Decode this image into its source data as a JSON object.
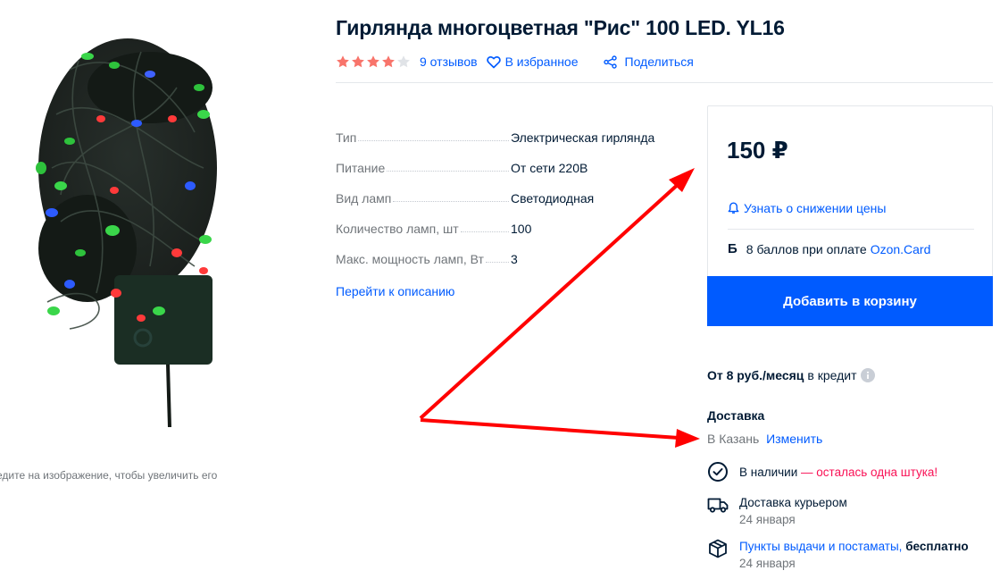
{
  "product": {
    "title": "Гирлянда многоцветная \"Рис\" 100 LED. YL16",
    "rating": 4,
    "max_rating": 5,
    "reviews_label": "9 отзывов",
    "favorite_label": "В избранное",
    "share_label": "Поделиться",
    "zoom_hint": "едите на изображение, чтобы увеличить его"
  },
  "specs": [
    {
      "name": "Тип",
      "value": "Электрическая гирлянда"
    },
    {
      "name": "Питание",
      "value": "От сети 220В"
    },
    {
      "name": "Вид ламп",
      "value": "Светодиодная"
    },
    {
      "name": "Количество ламп, шт",
      "value": "100"
    },
    {
      "name": "Макс. мощность ламп, Вт",
      "value": "3"
    }
  ],
  "description_link": "Перейти к описанию",
  "price_card": {
    "price": "150 ₽",
    "notify_label": "Узнать о снижении цены",
    "bonus_icon": "Б",
    "bonus_text": "8 баллов при оплате",
    "bonus_link": "Ozon.Card",
    "add_to_cart": "Добавить в корзину"
  },
  "credit": {
    "amount": "От 8 руб./месяц",
    "suffix": "в кредит"
  },
  "delivery": {
    "title": "Доставка",
    "city": "В Казань",
    "change_label": "Изменить",
    "stock": "В наличии",
    "stock_warning": "— осталась одна штука!",
    "courier_label": "Доставка курьером",
    "courier_date": "24 января",
    "pickup_label": "Пункты выдачи и постаматы,",
    "pickup_price": "бесплатно",
    "pickup_date": "24 января"
  },
  "colors": {
    "accent": "#005bff",
    "star": "#f8746b",
    "warning": "#f91155",
    "arrow": "#ff0000"
  }
}
